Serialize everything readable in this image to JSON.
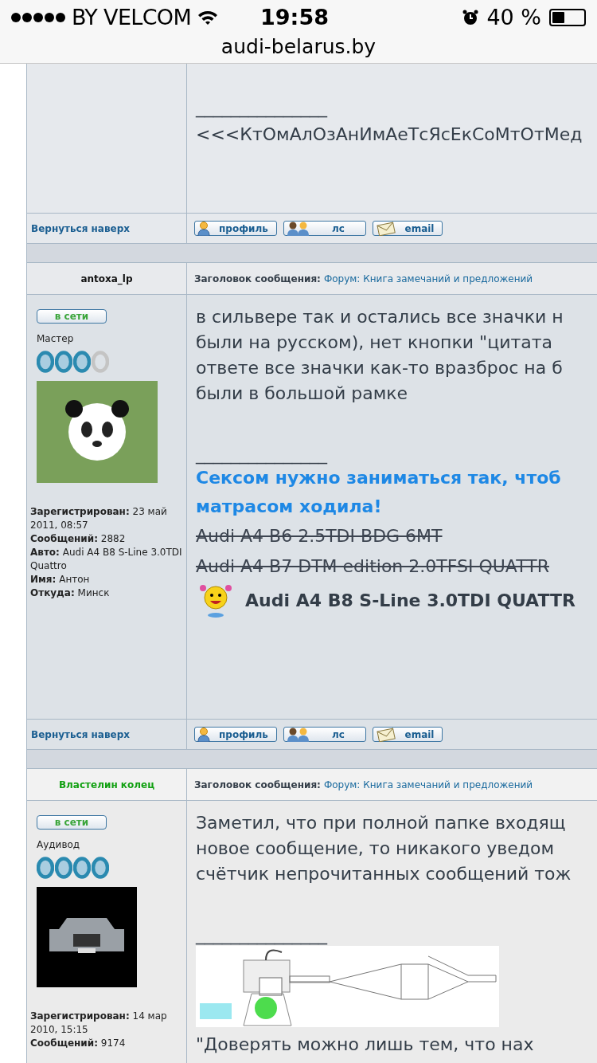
{
  "status_bar": {
    "carrier": "BY VELCOM",
    "time": "19:58",
    "battery_percent": "40 %",
    "url": "audi-belarus.by"
  },
  "top_post": {
    "signature_line": "_______________",
    "signature_text": "<<<КтОмАлОзАнИмАеТсЯсЕкСоМтОтМед",
    "back_to_top": "Вернуться наверх",
    "buttons": [
      {
        "kind": "profile",
        "label": "профиль"
      },
      {
        "kind": "pm",
        "label": "лс"
      },
      {
        "kind": "email",
        "label": "email"
      }
    ]
  },
  "posts": [
    {
      "author": "antoxa_lp",
      "color": "#111111",
      "subject_label": "Заголовок сообщения:",
      "subject": "Форум: Книга замечаний и предложений",
      "online_badge": "в сети",
      "rank": "Мастер",
      "stars": 3,
      "avatar": {
        "kind": "panda"
      },
      "profile": [
        "**Зарегистрирован:** 23 май 2011, 08:57",
        "**Сообщений:** 2882",
        "**Авто:** Audi A4 B8 S-Line 3.0TDI Quattro",
        "**Имя:** Антон",
        "**Откуда:** Минск"
      ],
      "body": [
        "в сильвере так и остались все значки н",
        "были на русском), нет кнопки \"цитата",
        "ответе все значки как-то вразброс на б",
        "были в большой рамке"
      ],
      "signature": [
        {
          "kind": "rule",
          "text": "_______________"
        },
        {
          "kind": "highlight",
          "text": "Сексом нужно заниматься так, чтоб"
        },
        {
          "kind": "highlight",
          "text": "матрасом ходила!"
        },
        {
          "kind": "struck",
          "text": "Audi A4 B6 2.5TDI BDG 6MT"
        },
        {
          "kind": "struck",
          "text": "Audi A4 B7 DTM edition 2.0TFSI QUATTR"
        },
        {
          "kind": "smiley",
          "text": "Audi A4 B8 S-Line 3.0TDI QUATTR"
        }
      ],
      "back_to_top": "Вернуться наверх",
      "buttons": [
        {
          "kind": "profile",
          "label": "профиль"
        },
        {
          "kind": "pm",
          "label": "лс"
        },
        {
          "kind": "email",
          "label": "email"
        }
      ]
    },
    {
      "author": "Властелин колец",
      "color": "#11a011",
      "subject_label": "Заголовок сообщения:",
      "subject": "Форум: Книга замечаний и предложений",
      "online_badge": "в сети",
      "rank": "Аудивод",
      "stars": 4,
      "avatar": {
        "kind": "car"
      },
      "profile": [
        "**Зарегистрирован:** 14 мар 2010, 15:15",
        "**Сообщений:** 9174"
      ],
      "body": [
        "Заметил, что при полной папке входящ",
        "новое сообщение, то никакого уведом",
        "счётчик непрочитанных сообщений тож"
      ],
      "signature": [
        {
          "kind": "rule",
          "text": "_______________"
        },
        {
          "kind": "engine"
        },
        {
          "kind": "plain",
          "text": "\"Доверять можно лишь тем, что нах"
        }
      ]
    }
  ]
}
